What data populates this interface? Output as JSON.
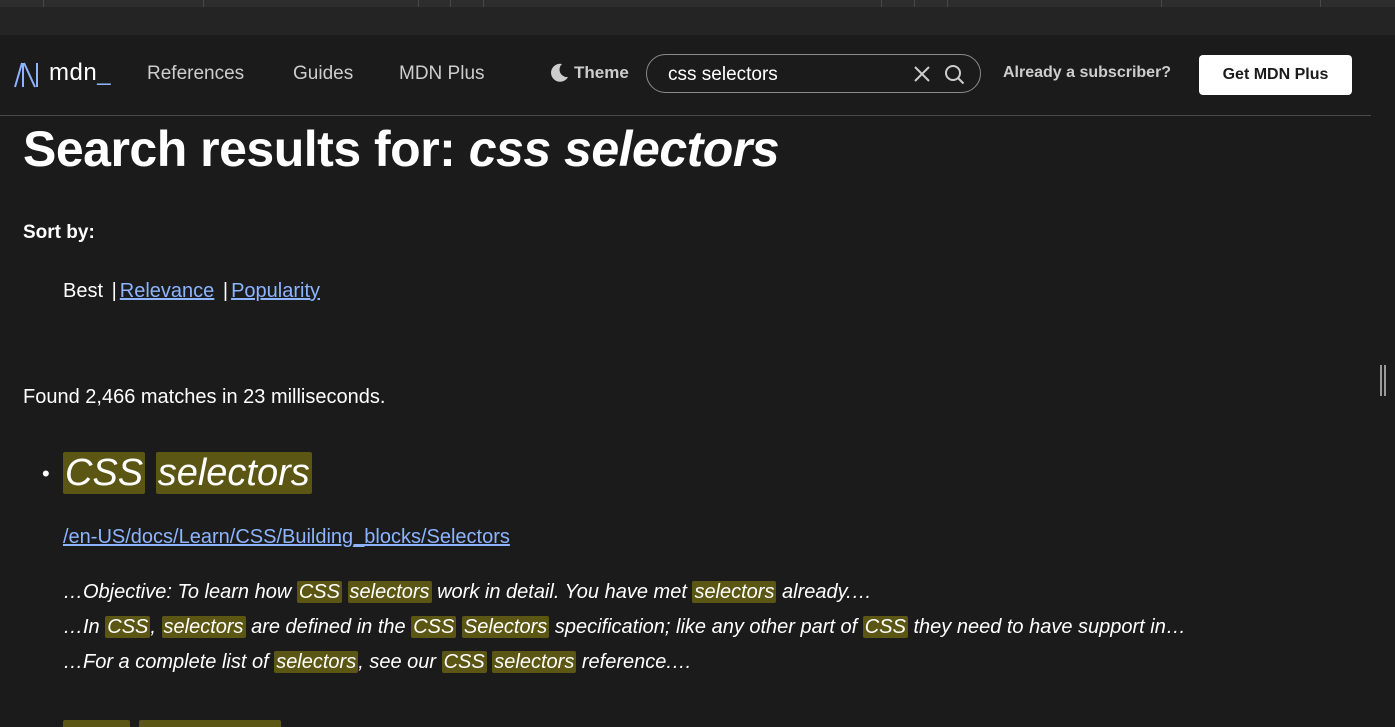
{
  "header": {
    "logo_text": "mdn",
    "nav": [
      "References",
      "Guides",
      "MDN Plus"
    ],
    "theme_label": "Theme",
    "search_value": "css selectors",
    "subscriber_link": "Already a subscriber?",
    "cta_label": "Get MDN Plus"
  },
  "page": {
    "title_prefix": "Search results for: ",
    "title_query": "css selectors",
    "sort_label": "Sort by:",
    "sort_current": "Best",
    "sort_links": [
      "Relevance",
      "Popularity"
    ],
    "found_text": "Found 2,466 matches in 23 milliseconds."
  },
  "results": [
    {
      "title_words": [
        "CSS",
        "selectors"
      ],
      "url": "/en-US/docs/Learn/CSS/Building_blocks/Selectors",
      "snippets": [
        [
          {
            "t": "…Objective: To learn how "
          },
          {
            "t": "CSS",
            "h": true
          },
          {
            "t": " "
          },
          {
            "t": "selectors",
            "h": true
          },
          {
            "t": " work in detail. You have met "
          },
          {
            "t": "selectors",
            "h": true
          },
          {
            "t": " already.…"
          }
        ],
        [
          {
            "t": "…In "
          },
          {
            "t": "CSS",
            "h": true
          },
          {
            "t": ", "
          },
          {
            "t": "selectors",
            "h": true
          },
          {
            "t": " are defined in the "
          },
          {
            "t": "CSS",
            "h": true
          },
          {
            "t": " "
          },
          {
            "t": "Selectors",
            "h": true
          },
          {
            "t": " specification; like any other part of "
          },
          {
            "t": "CSS",
            "h": true
          },
          {
            "t": " they need to have support in…"
          }
        ],
        [
          {
            "t": "…For a complete list of "
          },
          {
            "t": "selectors",
            "h": true
          },
          {
            "t": ", see our "
          },
          {
            "t": "CSS",
            "h": true
          },
          {
            "t": " "
          },
          {
            "t": "selectors",
            "h": true
          },
          {
            "t": " reference.…"
          }
        ]
      ]
    }
  ],
  "colors": {
    "background": "#1b1b1b",
    "link": "#8cb4ff",
    "highlight": "#5c5614",
    "text": "#ffffff"
  }
}
